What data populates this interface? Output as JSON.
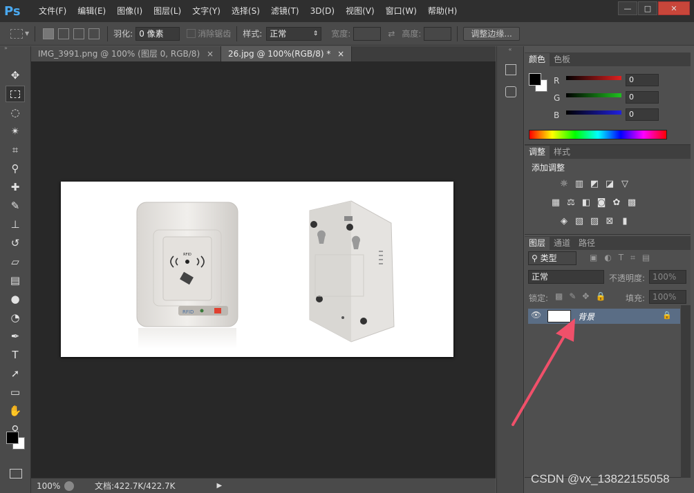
{
  "app": {
    "logo": "Ps"
  },
  "menu": [
    "文件(F)",
    "编辑(E)",
    "图像(I)",
    "图层(L)",
    "文字(Y)",
    "选择(S)",
    "滤镜(T)",
    "3D(D)",
    "视图(V)",
    "窗口(W)",
    "帮助(H)"
  ],
  "window_controls": {
    "minimize": "—",
    "restore": "□",
    "close": "✕"
  },
  "options": {
    "feather_label": "羽化:",
    "feather_value": "0 像素",
    "antialias_label": "消除锯齿",
    "style_label": "样式:",
    "style_value": "正常",
    "width_label": "宽度:",
    "height_label": "高度:",
    "refine_button": "调整边缘..."
  },
  "tabs": [
    {
      "label": "IMG_3991.png @ 100% (图层 0, RGB/8)",
      "close": "×"
    },
    {
      "label": "26.jpg @ 100%(RGB/8) *",
      "close": "×"
    }
  ],
  "status": {
    "zoom": "100%",
    "doc": "文档:422.7K/422.7K"
  },
  "color_panel": {
    "tabs": [
      "颜色",
      "色板"
    ],
    "channels": [
      {
        "label": "R",
        "value": "0",
        "color": "#e02020"
      },
      {
        "label": "G",
        "value": "0",
        "color": "#20c020"
      },
      {
        "label": "B",
        "value": "0",
        "color": "#2020e0"
      }
    ]
  },
  "adjust_panel": {
    "tabs": [
      "调整",
      "样式"
    ],
    "title": "添加调整"
  },
  "layers_panel": {
    "tabs": [
      "图层",
      "通道",
      "路径"
    ],
    "kind_label": "类型",
    "blend_mode": "正常",
    "opacity_label": "不透明度:",
    "opacity_value": "100%",
    "lock_label": "锁定:",
    "fill_label": "填充:",
    "fill_value": "100%",
    "layer_name": "背景"
  },
  "device": {
    "rfid_label": "RFID",
    "front_badge": "RFID"
  },
  "watermark": "CSDN @vx_13822155058"
}
